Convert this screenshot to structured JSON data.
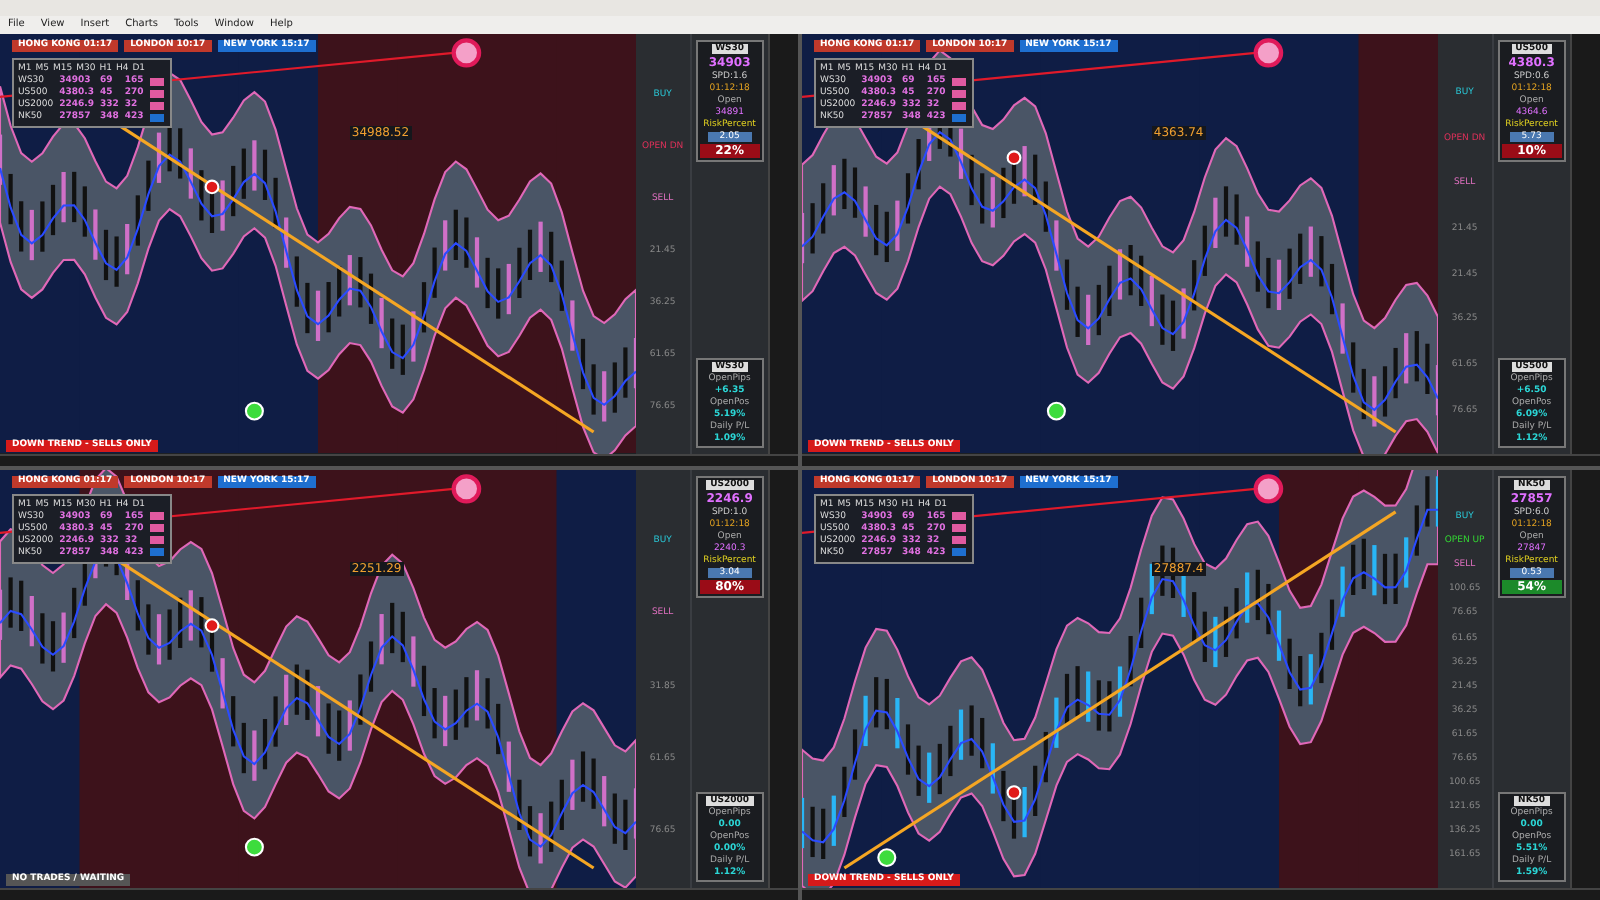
{
  "menu": [
    "File",
    "View",
    "Insert",
    "Charts",
    "Tools",
    "Window",
    "Help"
  ],
  "panels": [
    {
      "kind": "down",
      "zones": [
        {
          "kind": "buy"
        },
        {
          "kind": "buy"
        },
        {
          "kind": "buy"
        },
        {
          "kind": "buy"
        },
        {
          "kind": "sell"
        },
        {
          "kind": "sell"
        },
        {
          "kind": "sell"
        },
        {
          "kind": "sell"
        }
      ],
      "sessions": [
        {
          "label": "HONG KONG 01:17",
          "color": "#c0392b"
        },
        {
          "label": "LONDON 10:17",
          "color": "#c0392b"
        },
        {
          "label": "NEW YORK 15:17",
          "color": "#1e6fd0"
        }
      ],
      "table": {
        "header": [
          "M1",
          "M5",
          "M15",
          "M30",
          "H1",
          "H4",
          "D1"
        ],
        "rows": [
          {
            "cells": [
              "WS30",
              "34903",
              "69",
              "165"
            ],
            "color": "#e05aa0"
          },
          {
            "cells": [
              "US500",
              "4380.3",
              "45",
              "270"
            ],
            "color": "#e05aa0"
          },
          {
            "cells": [
              "US2000",
              "2246.9",
              "332",
              "32"
            ],
            "color": "#e05aa0"
          },
          {
            "cells": [
              "NK50",
              "27857",
              "348",
              "423"
            ],
            "color": "#1e6fd0"
          }
        ]
      },
      "price_tag": "34988.52",
      "status": {
        "kind": "down",
        "text": "DOWN TREND - SELLS ONLY"
      },
      "signals": [
        {
          "kind": "buy",
          "text": "BUY"
        },
        {
          "kind": "sell",
          "text": "OPEN DN"
        },
        {
          "kind": "sellz",
          "text": "SELL"
        }
      ],
      "ticks": [
        "21.45",
        "36.25",
        "61.65",
        "76.65"
      ],
      "info": {
        "symbol": "WS30",
        "price": "34903",
        "spread": "SPD:1.6",
        "timer": "01:12:18",
        "open_label": "Open",
        "open": "34891",
        "rp_label": "RiskPercent",
        "rp": "2.05",
        "risk": {
          "text": "22%",
          "kind": "sell"
        }
      },
      "pl": {
        "symbol": "WS30",
        "l1": "OpenPips",
        "v1": "+6.35",
        "l2": "OpenPos",
        "v2": "5.19%",
        "l3": "Daily P/L",
        "v3": "1.09%"
      }
    },
    {
      "kind": "down",
      "zones": [
        {
          "kind": "buy"
        },
        {
          "kind": "buy"
        },
        {
          "kind": "buy"
        },
        {
          "kind": "buy"
        },
        {
          "kind": "buy"
        },
        {
          "kind": "buy"
        },
        {
          "kind": "buy"
        },
        {
          "kind": "sell"
        }
      ],
      "sessions": [
        {
          "label": "HONG KONG 01:17",
          "color": "#c0392b"
        },
        {
          "label": "LONDON 10:17",
          "color": "#c0392b"
        },
        {
          "label": "NEW YORK 15:17",
          "color": "#1e6fd0"
        }
      ],
      "table": {
        "header": [
          "M1",
          "M5",
          "M15",
          "M30",
          "H1",
          "H4",
          "D1"
        ],
        "rows": [
          {
            "cells": [
              "WS30",
              "34903",
              "69",
              "165"
            ],
            "color": "#e05aa0"
          },
          {
            "cells": [
              "US500",
              "4380.3",
              "45",
              "270"
            ],
            "color": "#e05aa0"
          },
          {
            "cells": [
              "US2000",
              "2246.9",
              "332",
              "32"
            ],
            "color": "#e05aa0"
          },
          {
            "cells": [
              "NK50",
              "27857",
              "348",
              "423"
            ],
            "color": "#1e6fd0"
          }
        ]
      },
      "price_tag": "4363.74",
      "status": {
        "kind": "down",
        "text": "DOWN TREND - SELLS ONLY"
      },
      "signals": [
        {
          "kind": "buy",
          "text": "BUY"
        },
        {
          "kind": "sell",
          "text": "OPEN DN"
        },
        {
          "kind": "sellz",
          "text": "SELL"
        }
      ],
      "ticks": [
        "21.45",
        "21.45",
        "36.25",
        "61.65",
        "76.65"
      ],
      "info": {
        "symbol": "US500",
        "price": "4380.3",
        "spread": "SPD:0.6",
        "timer": "01:12:18",
        "open_label": "Open",
        "open": "4364.6",
        "rp_label": "RiskPercent",
        "rp": "5.73",
        "risk": {
          "text": "10%",
          "kind": "sell"
        }
      },
      "pl": {
        "symbol": "US500",
        "l1": "OpenPips",
        "v1": "+6.50",
        "l2": "OpenPos",
        "v2": "6.09%",
        "l3": "Daily P/L",
        "v3": "1.12%"
      }
    },
    {
      "kind": "down",
      "zones": [
        {
          "kind": "buy"
        },
        {
          "kind": "sell"
        },
        {
          "kind": "sell"
        },
        {
          "kind": "sell"
        },
        {
          "kind": "sell"
        },
        {
          "kind": "sell"
        },
        {
          "kind": "sell"
        },
        {
          "kind": "buy"
        }
      ],
      "sessions": [
        {
          "label": "HONG KONG 01:17",
          "color": "#c0392b"
        },
        {
          "label": "LONDON 10:17",
          "color": "#c0392b"
        },
        {
          "label": "NEW YORK 15:17",
          "color": "#1e6fd0"
        }
      ],
      "table": {
        "header": [
          "M1",
          "M5",
          "M15",
          "M30",
          "H1",
          "H4",
          "D1"
        ],
        "rows": [
          {
            "cells": [
              "WS30",
              "34903",
              "69",
              "165"
            ],
            "color": "#e05aa0"
          },
          {
            "cells": [
              "US500",
              "4380.3",
              "45",
              "270"
            ],
            "color": "#e05aa0"
          },
          {
            "cells": [
              "US2000",
              "2246.9",
              "332",
              "32"
            ],
            "color": "#e05aa0"
          },
          {
            "cells": [
              "NK50",
              "27857",
              "348",
              "423"
            ],
            "color": "#1e6fd0"
          }
        ]
      },
      "price_tag": "2251.29",
      "status": {
        "kind": "wait",
        "text": "NO TRADES / WAITING"
      },
      "signals": [
        {
          "kind": "buy",
          "text": "BUY"
        },
        {
          "kind": "sellz",
          "text": "SELL"
        }
      ],
      "ticks": [
        "31.85",
        "61.65",
        "76.65"
      ],
      "info": {
        "symbol": "US2000",
        "price": "2246.9",
        "spread": "SPD:1.0",
        "timer": "01:12:18",
        "open_label": "Open",
        "open": "2240.3",
        "rp_label": "RiskPercent",
        "rp": "3.04",
        "risk": {
          "text": "80%",
          "kind": "sell"
        }
      },
      "pl": {
        "symbol": "US2000",
        "l1": "OpenPips",
        "v1": "0.00",
        "l2": "OpenPos",
        "v2": "0.00%",
        "l3": "Daily P/L",
        "v3": "1.12%"
      }
    },
    {
      "kind": "up",
      "zones": [
        {
          "kind": "buy"
        },
        {
          "kind": "buy"
        },
        {
          "kind": "buy"
        },
        {
          "kind": "buy"
        },
        {
          "kind": "buy"
        },
        {
          "kind": "buy"
        },
        {
          "kind": "sell"
        },
        {
          "kind": "sell"
        }
      ],
      "sessions": [
        {
          "label": "HONG KONG 01:17",
          "color": "#c0392b"
        },
        {
          "label": "LONDON 10:17",
          "color": "#c0392b"
        },
        {
          "label": "NEW YORK 15:17",
          "color": "#1e6fd0"
        }
      ],
      "table": {
        "header": [
          "M1",
          "M5",
          "M15",
          "M30",
          "H1",
          "H4",
          "D1"
        ],
        "rows": [
          {
            "cells": [
              "WS30",
              "34903",
              "69",
              "165"
            ],
            "color": "#e05aa0"
          },
          {
            "cells": [
              "US500",
              "4380.3",
              "45",
              "270"
            ],
            "color": "#e05aa0"
          },
          {
            "cells": [
              "US2000",
              "2246.9",
              "332",
              "32"
            ],
            "color": "#e05aa0"
          },
          {
            "cells": [
              "NK50",
              "27857",
              "348",
              "423"
            ],
            "color": "#1e6fd0"
          }
        ]
      },
      "price_tag": "27887.4",
      "status": {
        "kind": "down",
        "text": "DOWN TREND - SELLS ONLY"
      },
      "signals": [
        {
          "kind": "buy",
          "text": "BUY"
        },
        {
          "kind": "up",
          "text": "OPEN UP"
        },
        {
          "kind": "sellz",
          "text": "SELL"
        }
      ],
      "ticks": [
        "100.65",
        "76.65",
        "61.65",
        "36.25",
        "21.45",
        "36.25",
        "61.65",
        "76.65",
        "100.65",
        "121.65",
        "136.25",
        "161.65"
      ],
      "info": {
        "symbol": "NK50",
        "price": "27857",
        "spread": "SPD:6.0",
        "timer": "01:12:18",
        "open_label": "Open",
        "open": "27847",
        "rp_label": "RiskPercent",
        "rp": "0.53",
        "risk": {
          "text": "54%",
          "kind": "buy"
        }
      },
      "pl": {
        "symbol": "NK50",
        "l1": "OpenPips",
        "v1": "0.00",
        "l2": "OpenPos",
        "v2": "5.51%",
        "l3": "Daily P/L",
        "v3": "1.59%"
      }
    }
  ]
}
